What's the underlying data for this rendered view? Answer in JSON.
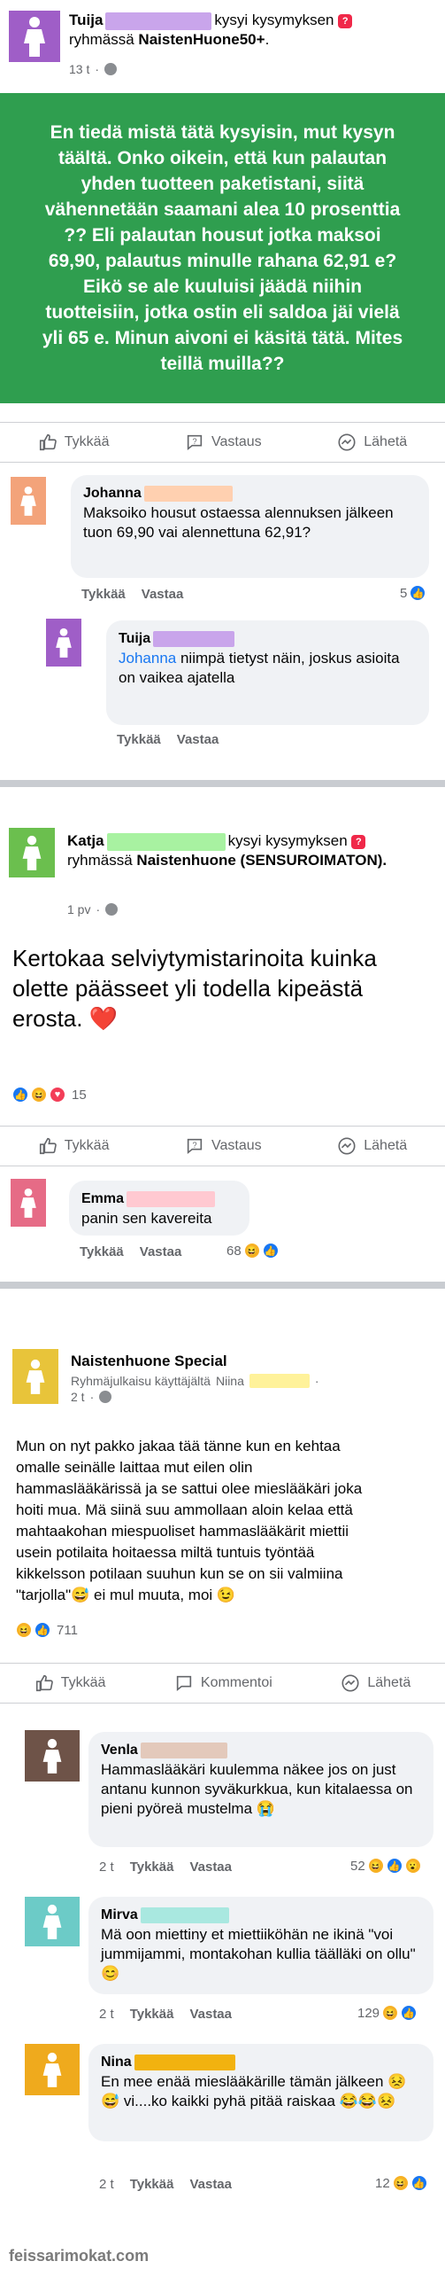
{
  "colors": {
    "green_post_bg": "#2f9e4f",
    "link_blue": "#1877f2",
    "avatar_purple": "#9f5ec7",
    "avatar_salmon": "#f3a37a",
    "avatar_green": "#6bbf4e",
    "avatar_pink": "#e66b86",
    "avatar_yellow": "#e8c43a",
    "avatar_brown": "#6e5348",
    "avatar_teal": "#6ccbc7",
    "avatar_orange": "#efaa1d",
    "blur_purple": "#c9a5eb",
    "blur_peach": "#ffd0b0",
    "blur_green": "#a8f2a1",
    "blur_pink": "#ffc9d1",
    "blur_yellow": "#fff29a",
    "blur_tan": "#e3c9bb",
    "blur_teal": "#a9e8e0",
    "blur_gold": "#f2b20f"
  },
  "post1": {
    "author": "Tuija",
    "action_text": "kysyi kysymyksen",
    "group_prefix": "ryhmässä",
    "group_name": "NaistenHuone50+",
    "group_suffix": ".",
    "time": "13 t",
    "body": "En tiedä mistä tätä kysyisin, mut kysyn täältä. Onko oikein, että kun palautan yhden tuotteen paketistani, siitä vähennetään saamani alea 10 prosenttia ?? Eli palautan housut jotka maksoi 69,90, palautus minulle rahana 62,91 e? Eikö se ale kuuluisi jäädä niihin tuotteisiin, jotka ostin eli saldoa jäi vielä yli 65 e. Minun aivoni ei käsitä tätä. Mites teillä muilla??",
    "actions": {
      "like": "Tykkää",
      "answer": "Vastaus",
      "send": "Lähetä"
    },
    "comments": [
      {
        "name": "Johanna",
        "text": "Maksoiko housut ostaessa alennuksen jälkeen tuon 69,90 vai alennettuna 62,91?",
        "like": "Tykkää",
        "reply": "Vastaa",
        "reactions": "5"
      },
      {
        "name": "Tuija",
        "mention": "Johanna",
        "text": " niimpä tietyst näin, joskus asioita on vaikea ajatella",
        "like": "Tykkää",
        "reply": "Vastaa"
      }
    ]
  },
  "post2": {
    "author": "Katja",
    "action_text": "kysyi kysymyksen",
    "group_prefix": "ryhmässä",
    "group_name": "Naistenhuone (SENSUROIMATON).",
    "time": "1 pv",
    "body": "Kertokaa selviytymistarinoita kuinka olette päässeet yli todella kipeästä erosta. ❤️",
    "reaction_count": "15",
    "actions": {
      "like": "Tykkää",
      "answer": "Vastaus",
      "send": "Lähetä"
    },
    "comments": [
      {
        "name": "Emma",
        "text": "panin sen kavereita",
        "like": "Tykkää",
        "reply": "Vastaa",
        "reactions": "68"
      }
    ]
  },
  "post3": {
    "group_name": "Naistenhuone Special",
    "sub_prefix": "Ryhmäjulkaisu käyttäjältä",
    "sub_name": "Niina",
    "time": "2 t",
    "body": "Mun on nyt pakko jakaa tää tänne kun en kehtaa omalle seinälle laittaa mut eilen olin hammaslääkärissä ja se sattui olee mieslääkäri joka hoiti mua. Mä siinä suu ammollaan aloin kelaa että mahtaakohan miespuoliset hammaslääkärit miettii usein potilaita hoitaessa miltä tuntuis työntää kikkelsson potilaan suuhun kun se on sii valmiina \"tarjolla\"😅 ei mul muuta, moi 😉",
    "reaction_count": "711",
    "actions": {
      "like": "Tykkää",
      "comment": "Kommentoi",
      "send": "Lähetä"
    },
    "comments": [
      {
        "name": "Venla",
        "text": "Hammaslääkäri kuulemma näkee jos on just antanu kunnon syväkurkkua, kun kitalaessa on pieni pyöreä mustelma 😭",
        "time": "2 t",
        "like": "Tykkää",
        "reply": "Vastaa",
        "reactions": "52"
      },
      {
        "name": "Mirva",
        "text": "Mä oon miettiny et miettiiköhän ne ikinä \"voi jummijammi, montakohan kullia täälläki on ollu\" 😊",
        "time": "2 t",
        "like": "Tykkää",
        "reply": "Vastaa",
        "reactions": "129"
      },
      {
        "name": "Nina",
        "text": "En mee enää mieslääkärille tämän jälkeen 😣😅 vi....ko kaikki pyhä pitää raiskaa 😂😂😣",
        "time": "2 t",
        "like": "Tykkää",
        "reply": "Vastaa",
        "reactions": "12"
      }
    ]
  },
  "footer": "feissarimokat.com"
}
